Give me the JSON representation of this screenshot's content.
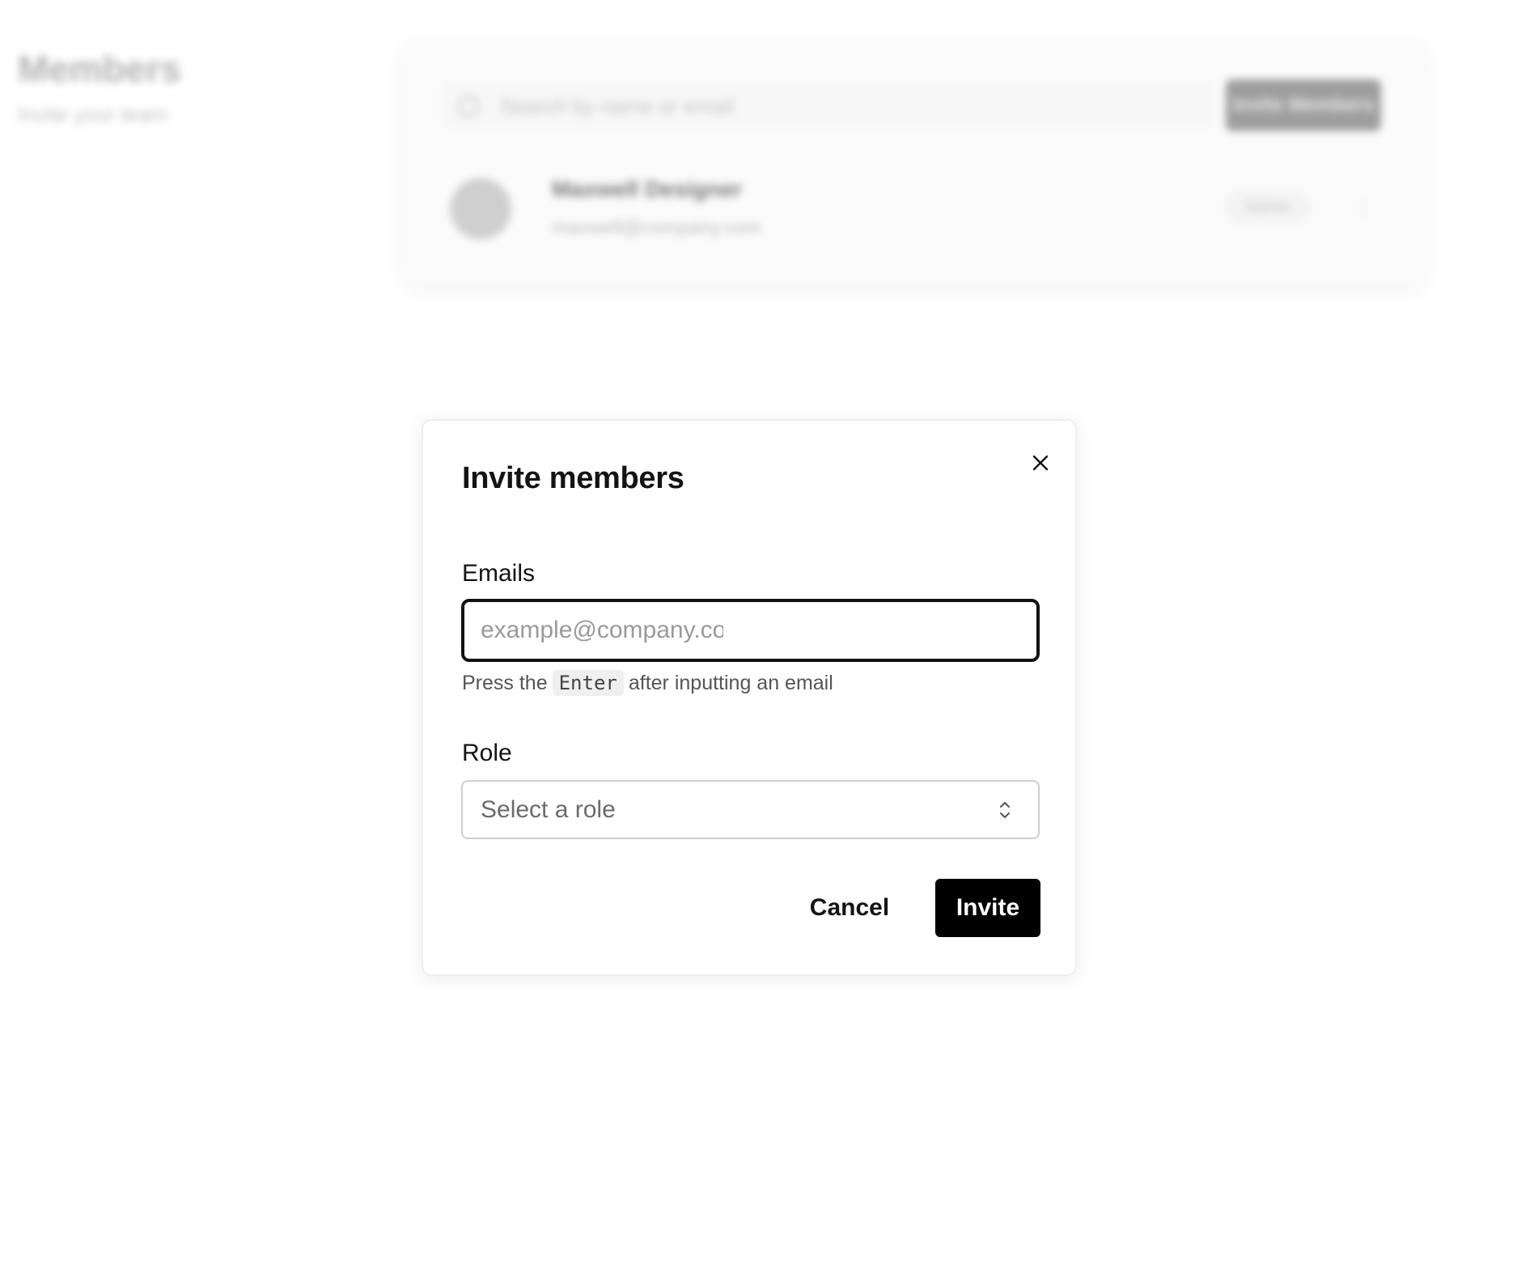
{
  "background_page": {
    "title": "Members",
    "subtitle": "Invite your team",
    "search_placeholder": "Search by name or email",
    "invite_button_label": "Invite Members",
    "member": {
      "name": "Maxwell Designer",
      "email": "maxwell@company.com",
      "role": "Admin"
    }
  },
  "dialog": {
    "title": "Invite members",
    "emails_label": "Emails",
    "email_placeholder": "example@company.com",
    "email_value": "",
    "helper_prefix": "Press the",
    "helper_key": "Enter",
    "helper_suffix": "after inputting an email",
    "role_label": "Role",
    "role_placeholder": "Select a role",
    "cancel_label": "Cancel",
    "invite_label": "Invite"
  },
  "icons": {
    "close": "close-icon",
    "role_select": "chevron-up-down-icon",
    "search": "search-icon",
    "row_menu": "more-icon"
  },
  "colors": {
    "primary_button": "#000000",
    "input_focus_border": "#111111",
    "select_border": "#cfcfcf",
    "kbd_background": "#efefef"
  }
}
